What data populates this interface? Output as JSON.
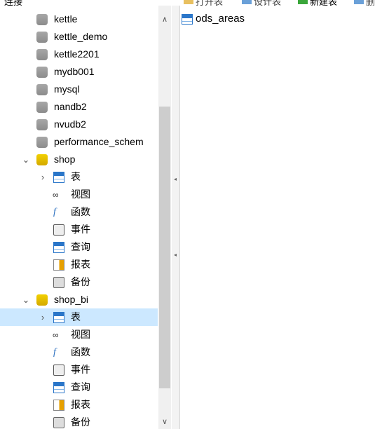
{
  "toolbar": {
    "connection_label": "连接",
    "open_table": "打开表",
    "design_table": "设计表",
    "new_table": "新建表",
    "delete_table": "删"
  },
  "tree": {
    "databases": [
      {
        "label": "kettle"
      },
      {
        "label": "kettle_demo"
      },
      {
        "label": "kettle2201"
      },
      {
        "label": "mydb001"
      },
      {
        "label": "mysql"
      },
      {
        "label": "nandb2"
      },
      {
        "label": "nvudb2"
      },
      {
        "label": "performance_schem"
      }
    ],
    "shop": {
      "label": "shop",
      "children": [
        {
          "label": "表",
          "icon": "table-icon"
        },
        {
          "label": "视图",
          "icon": "view-icon"
        },
        {
          "label": "函数",
          "icon": "function-icon"
        },
        {
          "label": "事件",
          "icon": "event-icon"
        },
        {
          "label": "查询",
          "icon": "query-icon"
        },
        {
          "label": "报表",
          "icon": "report-icon"
        },
        {
          "label": "备份",
          "icon": "backup-icon"
        }
      ]
    },
    "shop_bi": {
      "label": "shop_bi",
      "children": [
        {
          "label": "表",
          "icon": "table-icon"
        },
        {
          "label": "视图",
          "icon": "view-icon"
        },
        {
          "label": "函数",
          "icon": "function-icon"
        },
        {
          "label": "事件",
          "icon": "event-icon"
        },
        {
          "label": "查询",
          "icon": "query-icon"
        },
        {
          "label": "报表",
          "icon": "report-icon"
        },
        {
          "label": "备份",
          "icon": "backup-icon"
        }
      ]
    }
  },
  "objects": {
    "items": [
      {
        "label": "ods_areas"
      }
    ]
  },
  "colors": {
    "selection": "#cce8ff",
    "db_gray": "#999999",
    "db_yellow": "#e6bd00",
    "table_blue": "#2a76c9"
  }
}
